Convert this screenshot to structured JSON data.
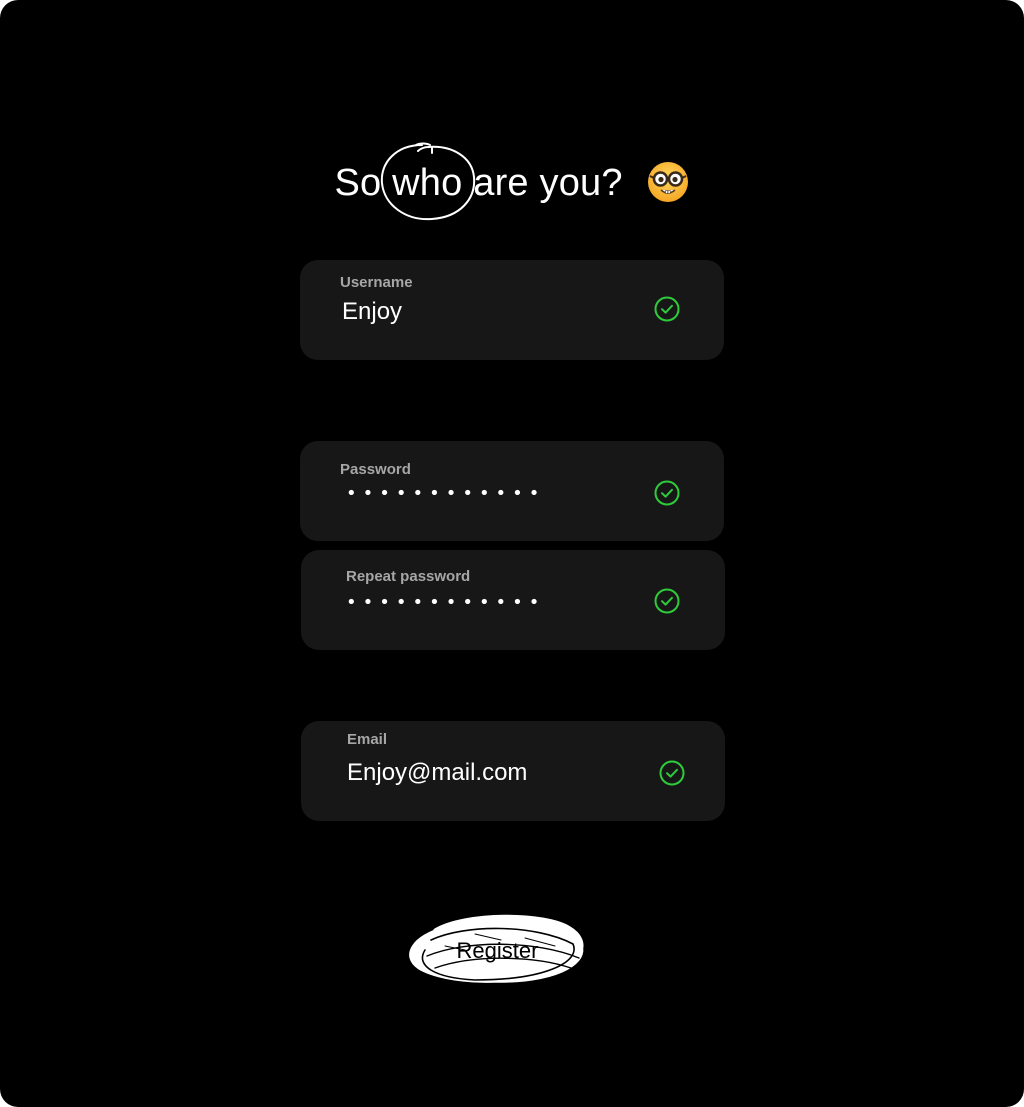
{
  "heading": {
    "part1": "So",
    "highlight": "who",
    "part2": "are you?",
    "emoji": "nerd-face-icon"
  },
  "fields": {
    "username": {
      "label": "Username",
      "value": "Enjoy",
      "status": "valid"
    },
    "password": {
      "label": "Password",
      "masked": "••••••••••••",
      "status": "valid"
    },
    "repeat_password": {
      "label": "Repeat password",
      "masked": "••••••••••••",
      "status": "valid"
    },
    "email": {
      "label": "Email",
      "value": "Enjoy@mail.com",
      "status": "valid"
    }
  },
  "register": {
    "label": "Register"
  },
  "colors": {
    "background": "#000000",
    "field_bg": "#171717",
    "label": "#a6a6a6",
    "check": "#2ecc3a",
    "text": "#ffffff"
  },
  "icons": {
    "valid": "check-circle-icon",
    "scribble": "scribble-highlight-icon"
  }
}
